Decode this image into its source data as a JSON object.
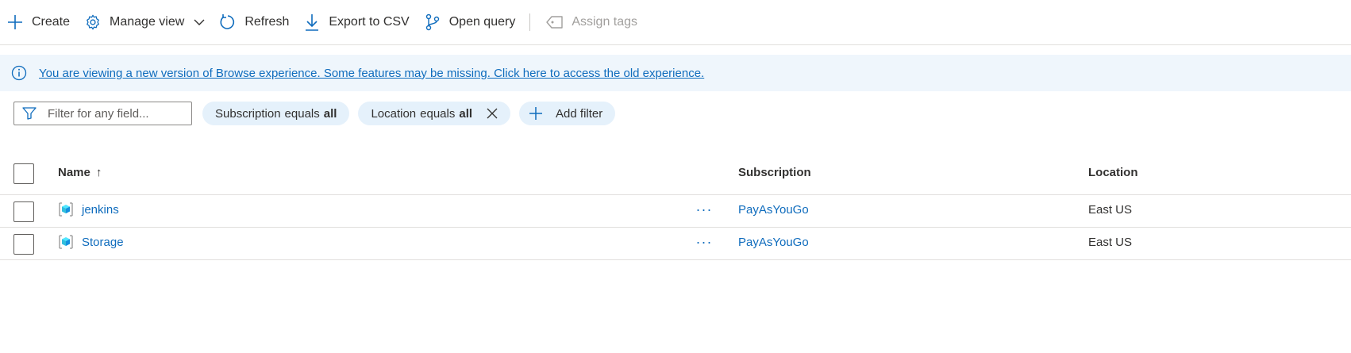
{
  "toolbar": {
    "create": "Create",
    "manage_view": "Manage view",
    "refresh": "Refresh",
    "export_csv": "Export to CSV",
    "open_query": "Open query",
    "assign_tags": "Assign tags"
  },
  "banner": {
    "text": "You are viewing a new version of Browse experience. Some features may be missing. Click here to access the old experience."
  },
  "filters": {
    "placeholder": "Filter for any field...",
    "subscription": {
      "field": "Subscription",
      "op": "equals",
      "value": "all"
    },
    "location": {
      "field": "Location",
      "op": "equals",
      "value": "all"
    },
    "add_filter": "Add filter"
  },
  "table": {
    "headers": {
      "name": "Name",
      "sort_indicator": "↑",
      "subscription": "Subscription",
      "location": "Location"
    },
    "rows": [
      {
        "name": "jenkins",
        "more": "···",
        "subscription": "PayAsYouGo",
        "location": "East US"
      },
      {
        "name": "Storage",
        "more": "···",
        "subscription": "PayAsYouGo",
        "location": "East US"
      }
    ]
  },
  "colors": {
    "accent": "#0f6cbd",
    "banner_bg": "#eff6fc",
    "pill_bg": "#e5f1fb",
    "disabled": "#a19f9d"
  }
}
